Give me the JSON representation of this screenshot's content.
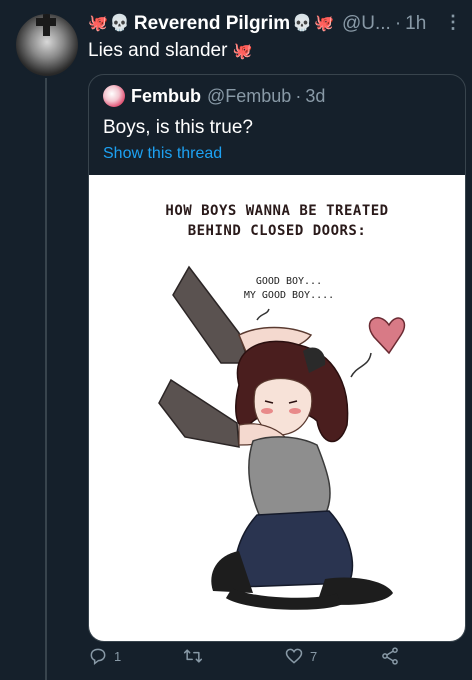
{
  "tweet": {
    "author_name": "Reverend Pilgrim",
    "handle": "@U...",
    "separator": "·",
    "time": "1h",
    "text": "Lies and slander",
    "text_emoji": "🐙"
  },
  "quoted_tweet": {
    "author_name": "Fembub",
    "handle": "@Fembub",
    "separator": "·",
    "time": "3d",
    "text": "Boys, is this true?",
    "show_thread": "Show this thread",
    "image": {
      "title_line1": "HOW BOYS WANNA BE TREATED",
      "title_line2": "BEHIND CLOSED DOORS:",
      "speech_line1": "GOOD BOY...",
      "speech_line2": "MY GOOD BOY...."
    }
  },
  "actions": {
    "reply_count": "1",
    "retweet_count": "",
    "like_count": "7"
  },
  "colors": {
    "background": "#15202b",
    "border": "#38444d",
    "secondary_text": "#8899a6",
    "link": "#1da1f2",
    "octopus": "#e0245e"
  },
  "icons": [
    "octopus-emoji",
    "skull-emoji",
    "more-icon",
    "reply-icon",
    "retweet-icon",
    "like-icon",
    "share-icon"
  ]
}
